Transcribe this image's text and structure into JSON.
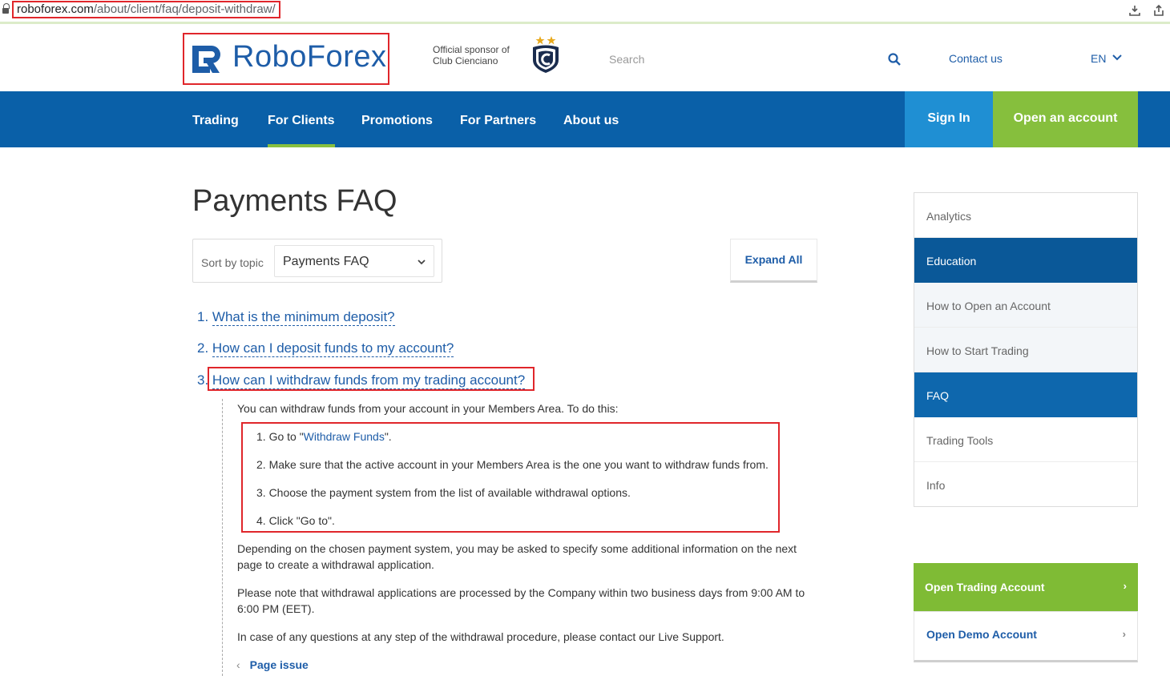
{
  "browser": {
    "url_domain": "roboforex.com",
    "url_path": "/about/client/faq/deposit-withdraw/"
  },
  "header": {
    "logo_text": "RoboForex",
    "sponsor_line1": "Official sponsor of",
    "sponsor_line2": "Club Cienciano",
    "search_placeholder": "Search",
    "contact": "Contact us",
    "language": "EN"
  },
  "nav": {
    "items": [
      {
        "label": "Trading"
      },
      {
        "label": "For Clients"
      },
      {
        "label": "Promotions"
      },
      {
        "label": "For Partners"
      },
      {
        "label": "About us"
      }
    ],
    "sign_in": "Sign In",
    "open_account": "Open an account"
  },
  "main": {
    "title": "Payments FAQ",
    "sort_label": "Sort by topic",
    "sort_value": "Payments FAQ",
    "expand_all": "Expand All",
    "questions": [
      {
        "num": "1.",
        "text": "What is the minimum deposit?"
      },
      {
        "num": "2.",
        "text": "How can I deposit funds to my account?"
      },
      {
        "num": "3.",
        "text": "How can I withdraw funds from my trading account?"
      }
    ],
    "answer": {
      "intro": "You can withdraw funds from your account in your Members Area. To do this:",
      "step1_prefix": "1. Go to \"",
      "step1_link": "Withdraw Funds",
      "step1_suffix": "\".",
      "step2": "2. Make sure that the active account in your Members Area is the one you want to withdraw funds from.",
      "step3": "3. Choose the payment system from the list of available withdrawal options.",
      "step4": "4. Click \"Go to\".",
      "para1": "Depending on the chosen payment system, you may be asked to specify some additional information on the next page to create a withdrawal application.",
      "para2": "Please note that withdrawal applications are processed by the Company within two business days from 9:00 AM to 6:00 PM (EET).",
      "para3": "In case of any questions at any step of the withdrawal procedure, please contact our Live Support."
    },
    "page_issue": "Page issue"
  },
  "sidebar": {
    "items": [
      {
        "label": "Analytics"
      },
      {
        "label": "Education"
      },
      {
        "label": "How to Open an Account"
      },
      {
        "label": "How to Start Trading"
      },
      {
        "label": "FAQ"
      },
      {
        "label": "Trading Tools"
      },
      {
        "label": "Info"
      }
    ],
    "cta_trading": "Open Trading Account",
    "cta_demo": "Open Demo Account",
    "chevron": "›"
  },
  "colors": {
    "brand_blue": "#0a60a8",
    "accent_green": "#86bf3d",
    "link_blue": "#1e5da8",
    "highlight_red": "#e0262b"
  }
}
